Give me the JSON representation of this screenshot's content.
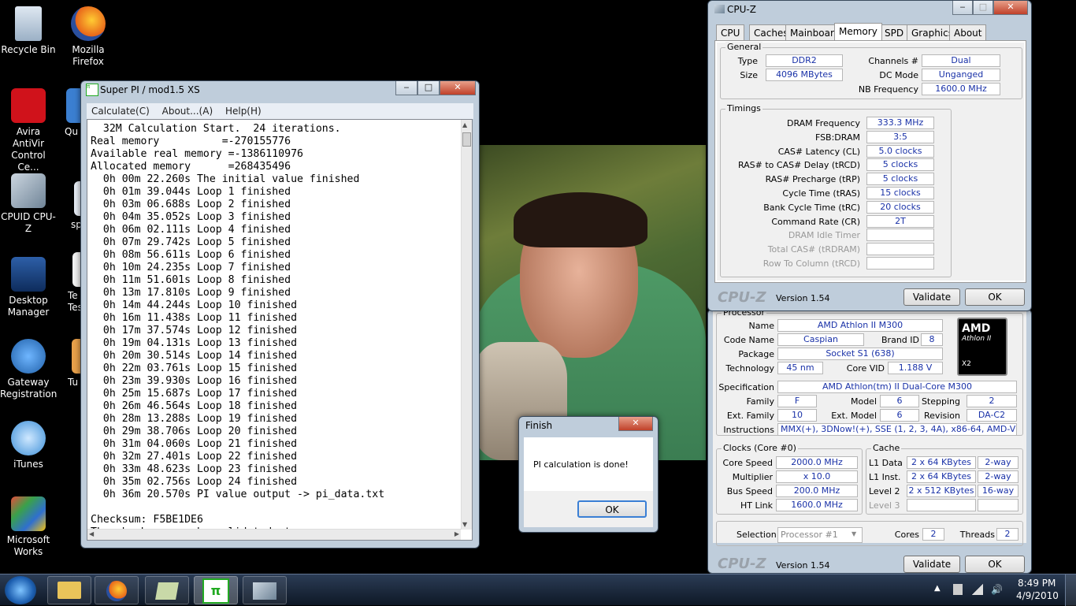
{
  "desktop": {
    "icons": [
      {
        "label": "Recycle Bin"
      },
      {
        "label": "Mozilla Firefox"
      },
      {
        "label": "Avira AntiVir Control Ce..."
      },
      {
        "label": "Qu"
      },
      {
        "label": "CPUID CPU-Z"
      },
      {
        "label": "sp"
      },
      {
        "label": "Desktop Manager"
      },
      {
        "label": "Te Tes"
      },
      {
        "label": "Gateway Registration"
      },
      {
        "label": "Tu D"
      },
      {
        "label": "iTunes"
      },
      {
        "label": "Microsoft Works"
      }
    ]
  },
  "superpi": {
    "title": "Super PI / mod1.5 XS",
    "menu": [
      "Calculate(C)",
      "About...(A)",
      "Help(H)"
    ],
    "lines": [
      "  32M Calculation Start.  24 iterations.",
      "Real memory          =-270155776",
      "Available real memory =-1386110976",
      "Allocated memory      =268435496",
      "  0h 00m 22.260s The initial value finished",
      "  0h 01m 39.044s Loop 1 finished",
      "  0h 03m 06.688s Loop 2 finished",
      "  0h 04m 35.052s Loop 3 finished",
      "  0h 06m 02.111s Loop 4 finished",
      "  0h 07m 29.742s Loop 5 finished",
      "  0h 08m 56.611s Loop 6 finished",
      "  0h 10m 24.235s Loop 7 finished",
      "  0h 11m 51.601s Loop 8 finished",
      "  0h 13m 17.810s Loop 9 finished",
      "  0h 14m 44.244s Loop 10 finished",
      "  0h 16m 11.438s Loop 11 finished",
      "  0h 17m 37.574s Loop 12 finished",
      "  0h 19m 04.131s Loop 13 finished",
      "  0h 20m 30.514s Loop 14 finished",
      "  0h 22m 03.761s Loop 15 finished",
      "  0h 23m 39.930s Loop 16 finished",
      "  0h 25m 15.687s Loop 17 finished",
      "  0h 26m 46.564s Loop 18 finished",
      "  0h 28m 13.288s Loop 19 finished",
      "  0h 29m 38.706s Loop 20 finished",
      "  0h 31m 04.060s Loop 21 finished",
      "  0h 32m 27.401s Loop 22 finished",
      "  0h 33m 48.623s Loop 23 finished",
      "  0h 35m 02.756s Loop 24 finished",
      "  0h 36m 20.570s PI value output -> pi_data.txt",
      "",
      "Checksum: F5BE1DE6",
      "The checksum can be validated at"
    ]
  },
  "finish": {
    "title": "Finish",
    "message": "PI calculation is done!",
    "ok": "OK"
  },
  "cpuz_mem": {
    "title": "CPU-Z",
    "tabs": [
      "CPU",
      "Caches",
      "Mainboard",
      "Memory",
      "SPD",
      "Graphics",
      "About"
    ],
    "general_title": "General",
    "type_label": "Type",
    "type": "DDR2",
    "size_label": "Size",
    "size": "4096 MBytes",
    "channels_label": "Channels #",
    "channels": "Dual",
    "dcmode_label": "DC Mode",
    "dcmode": "Unganged",
    "nbfreq_label": "NB Frequency",
    "nbfreq": "1600.0 MHz",
    "timings_title": "Timings",
    "timings": [
      {
        "label": "DRAM Frequency",
        "value": "333.3 MHz"
      },
      {
        "label": "FSB:DRAM",
        "value": "3:5"
      },
      {
        "label": "CAS# Latency (CL)",
        "value": "5.0 clocks"
      },
      {
        "label": "RAS# to CAS# Delay (tRCD)",
        "value": "5 clocks"
      },
      {
        "label": "RAS# Precharge (tRP)",
        "value": "5 clocks"
      },
      {
        "label": "Cycle Time (tRAS)",
        "value": "15 clocks"
      },
      {
        "label": "Bank Cycle Time (tRC)",
        "value": "20 clocks"
      },
      {
        "label": "Command Rate (CR)",
        "value": "2T"
      },
      {
        "label": "DRAM Idle Timer",
        "value": ""
      },
      {
        "label": "Total CAS# (tRDRAM)",
        "value": ""
      },
      {
        "label": "Row To Column (tRCD)",
        "value": ""
      }
    ],
    "logo": "CPU-Z",
    "version": "Version 1.54",
    "validate": "Validate",
    "ok": "OK"
  },
  "cpuz_cpu": {
    "processor_title": "Processor",
    "name_label": "Name",
    "name": "AMD Athlon II M300",
    "codename_label": "Code Name",
    "codename": "Caspian",
    "brandid_label": "Brand ID",
    "brandid": "8",
    "package_label": "Package",
    "package": "Socket S1 (638)",
    "technology_label": "Technology",
    "technology": "45 nm",
    "corevid_label": "Core VID",
    "corevid": "1.188 V",
    "spec_label": "Specification",
    "spec": "AMD Athlon(tm) II Dual-Core M300",
    "family_label": "Family",
    "family": "F",
    "model_label": "Model",
    "model": "6",
    "stepping_label": "Stepping",
    "stepping": "2",
    "extfamily_label": "Ext. Family",
    "extfamily": "10",
    "extmodel_label": "Ext. Model",
    "extmodel": "6",
    "revision_label": "Revision",
    "revision": "DA-C2",
    "instr_label": "Instructions",
    "instr": "MMX(+), 3DNow!(+), SSE (1, 2, 3, 4A), x86-64, AMD-V",
    "amd_logo": "AMD",
    "athlon_logo": "Athlon II",
    "x2": "X2",
    "clocks_title": "Clocks (Core #0)",
    "corespeed_label": "Core Speed",
    "corespeed": "2000.0 MHz",
    "multiplier_label": "Multiplier",
    "multiplier": "x 10.0",
    "busspeed_label": "Bus Speed",
    "busspeed": "200.0 MHz",
    "htlink_label": "HT Link",
    "htlink": "1600.0 MHz",
    "cache_title": "Cache",
    "l1d_label": "L1 Data",
    "l1d": "2 x 64 KBytes",
    "l1d_way": "2-way",
    "l1i_label": "L1 Inst.",
    "l1i": "2 x 64 KBytes",
    "l1i_way": "2-way",
    "l2_label": "Level 2",
    "l2": "2 x 512 KBytes",
    "l2_way": "16-way",
    "l3_label": "Level 3",
    "selection_label": "Selection",
    "selection": "Processor #1",
    "cores_label": "Cores",
    "cores": "2",
    "threads_label": "Threads",
    "threads": "2",
    "logo": "CPU-Z",
    "version": "Version 1.54",
    "validate": "Validate",
    "ok": "OK"
  },
  "taskbar": {
    "time": "8:49 PM",
    "date": "4/9/2010"
  }
}
